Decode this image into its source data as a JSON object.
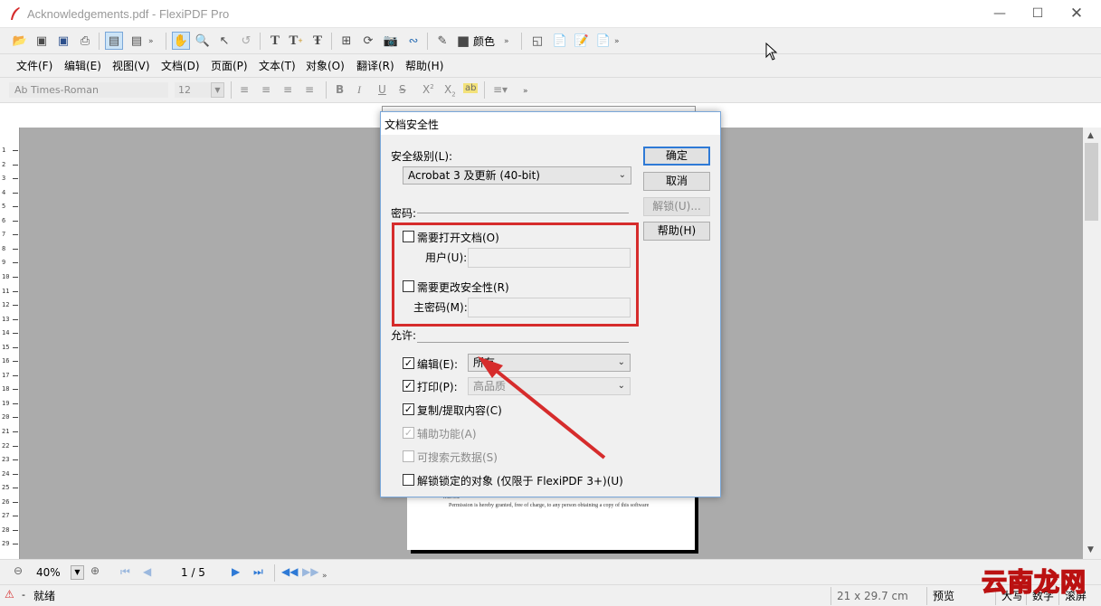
{
  "window": {
    "title": "Acknowledgements.pdf - FlexiPDF Pro",
    "controls": [
      "minimize",
      "maximize",
      "close"
    ]
  },
  "toolbar": {
    "color_label": "颜色"
  },
  "menu": {
    "items": [
      "文件(F)",
      "编辑(E)",
      "视图(V)",
      "文档(D)",
      "页面(P)",
      "文本(T)",
      "对象(O)",
      "翻译(R)",
      "帮助(H)"
    ]
  },
  "format": {
    "font_name": "Ab Times-Roman",
    "font_size": "12"
  },
  "ruler": {
    "numbers": [
      "1",
      "2",
      "3",
      "4",
      "5",
      "6",
      "7",
      "8",
      "9",
      "10",
      "11",
      "12",
      "13",
      "14",
      "15",
      "16",
      "17",
      "18",
      "19",
      "20",
      "21",
      "22",
      "23",
      "24",
      "25",
      "26",
      "27",
      "28",
      "29"
    ]
  },
  "document": {
    "line1": "reserved.",
    "line2": "Permission is hereby granted, free of charge, to any person obtaining a copy of this software"
  },
  "dialog": {
    "title": "文档安全性",
    "security_level_label": "安全级别(L):",
    "security_level_value": "Acrobat 3 及更新 (40-bit)",
    "password_group_label": "密码:",
    "require_open_label": "需要打开文档(O)",
    "user_label": "用户(U):",
    "require_change_label": "需要更改安全性(R)",
    "master_label": "主密码(M):",
    "permissions_label": "允许:",
    "edit_label": "编辑(E):",
    "edit_value": "所有",
    "print_label": "打印(P):",
    "print_value": "高品质",
    "copy_label": "复制/提取内容(C)",
    "accessibility_label": "辅助功能(A)",
    "searchable_label": "可搜索元数据(S)",
    "unlock_label": "解锁锁定的对象 (仅限于 FlexiPDF 3+)(U)",
    "buttons": {
      "ok": "确定",
      "cancel": "取消",
      "unlock": "解锁(U)...",
      "help": "帮助(H)"
    },
    "checked": {
      "require_open": false,
      "require_change": false,
      "edit": true,
      "print": true,
      "copy": true,
      "accessibility": true,
      "searchable": false,
      "unlock_objects": false
    }
  },
  "navigation": {
    "zoom": "40%",
    "page_indicator": "1 / 5"
  },
  "status": {
    "ready": "就绪",
    "page_size": "21 x 29.7 cm",
    "preview": "预览",
    "caps": "大写",
    "num": "数字",
    "scroll": "滚屏"
  },
  "watermark": {
    "text": "云南龙网"
  },
  "colors": {
    "highlight": "#d62c2c",
    "canvas": "#ababab",
    "primary_button_border": "#2f7ad6"
  }
}
